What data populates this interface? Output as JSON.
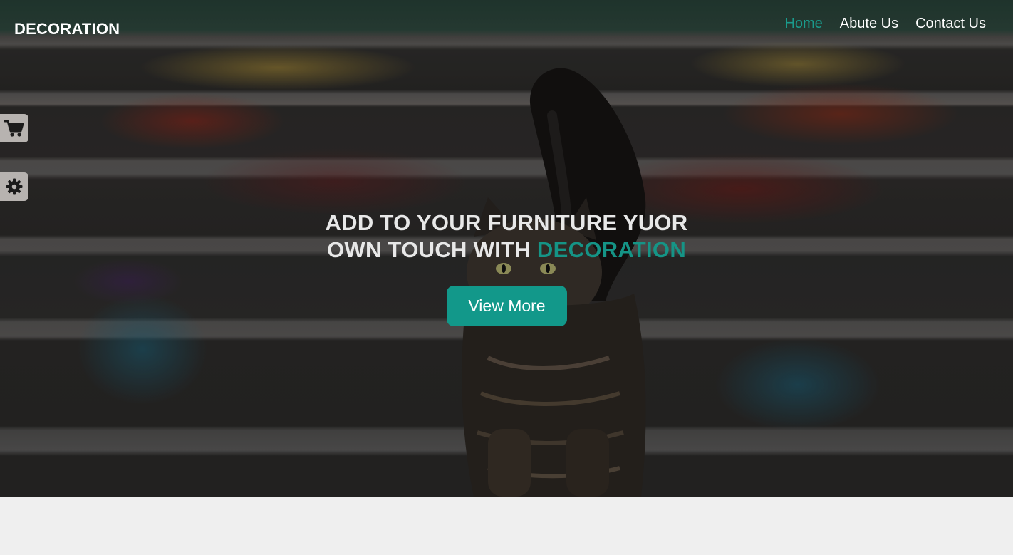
{
  "brand": {
    "logo": "DECORATION",
    "accent_color": "#12988a"
  },
  "nav": {
    "items": [
      {
        "label": "Home",
        "active": true
      },
      {
        "label": "Abute Us",
        "active": false
      },
      {
        "label": "Contact Us",
        "active": false
      }
    ]
  },
  "side_buttons": {
    "cart_icon": "cart-icon",
    "settings_icon": "gear-icon"
  },
  "hero": {
    "line1": "ADD TO YOUR FURNITURE YUOR",
    "line2_prefix": "OWN TOUCH WITH ",
    "line2_accent": "DECORATION",
    "cta_label": "View More"
  }
}
